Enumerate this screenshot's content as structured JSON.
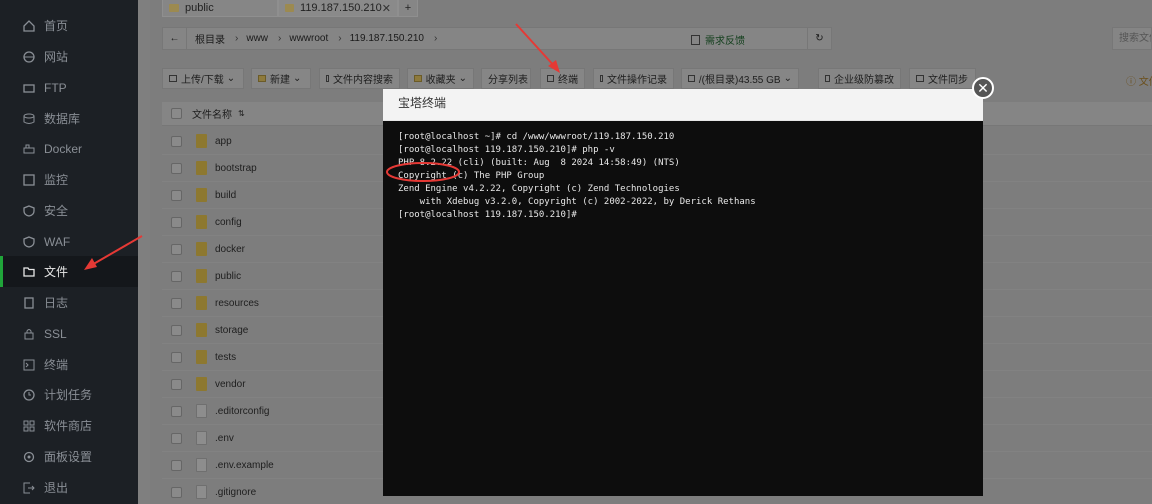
{
  "sidebar": {
    "items": [
      {
        "label": "首页",
        "icon": "home-icon"
      },
      {
        "label": "网站",
        "icon": "globe-icon"
      },
      {
        "label": "FTP",
        "icon": "ftp-icon"
      },
      {
        "label": "数据库",
        "icon": "database-icon"
      },
      {
        "label": "Docker",
        "icon": "docker-icon"
      },
      {
        "label": "监控",
        "icon": "monitor-icon"
      },
      {
        "label": "安全",
        "icon": "shield-icon"
      },
      {
        "label": "WAF",
        "icon": "waf-icon"
      },
      {
        "label": "文件",
        "icon": "folder-icon"
      },
      {
        "label": "日志",
        "icon": "log-icon"
      },
      {
        "label": "SSL",
        "icon": "ssl-icon"
      },
      {
        "label": "终端",
        "icon": "terminal-icon"
      },
      {
        "label": "计划任务",
        "icon": "clock-icon"
      },
      {
        "label": "软件商店",
        "icon": "store-icon"
      },
      {
        "label": "面板设置",
        "icon": "gear-icon"
      },
      {
        "label": "退出",
        "icon": "logout-icon"
      }
    ],
    "active_index": 8
  },
  "tabs": [
    {
      "label": "public"
    },
    {
      "label": "119.187.150.210"
    }
  ],
  "address": {
    "crumbs": [
      "根目录",
      "www",
      "wwwroot",
      "119.187.150.210"
    ]
  },
  "feedback_label": "需求反馈",
  "search_placeholder": "搜索文件/目录",
  "toolbar": {
    "upload": "上传/下载",
    "new": "新建",
    "content_search": "文件内容搜索",
    "favorites": "收藏夹",
    "share_list": "分享列表",
    "terminal": "终端",
    "op_log": "文件操作记录",
    "disk": "/(根目录)43.55 GB",
    "tamper": "企业级防篡改",
    "sync": "文件同步",
    "tip": "文件"
  },
  "table": {
    "header_name": "文件名称",
    "rows": [
      {
        "name": "app",
        "type": "folder"
      },
      {
        "name": "bootstrap",
        "type": "folder"
      },
      {
        "name": "build",
        "type": "folder"
      },
      {
        "name": "config",
        "type": "folder"
      },
      {
        "name": "docker",
        "type": "folder"
      },
      {
        "name": "public",
        "type": "folder"
      },
      {
        "name": "resources",
        "type": "folder"
      },
      {
        "name": "storage",
        "type": "folder"
      },
      {
        "name": "tests",
        "type": "folder"
      },
      {
        "name": "vendor",
        "type": "folder"
      },
      {
        "name": ".editorconfig",
        "type": "file"
      },
      {
        "name": ".env",
        "type": "file"
      },
      {
        "name": ".env.example",
        "type": "file"
      },
      {
        "name": ".gitignore",
        "type": "file"
      }
    ]
  },
  "modal": {
    "title": "宝塔终端",
    "lines": [
      "[root@localhost ~]# cd /www/wwwroot/119.187.150.210",
      "[root@localhost 119.187.150.210]# php -v",
      "PHP 8.2.22 (cli) (built: Aug  8 2024 14:58:49) (NTS)",
      "Copyright (c) The PHP Group",
      "Zend Engine v4.2.22, Copyright (c) Zend Technologies",
      "    with Xdebug v3.2.0, Copyright (c) 2002-2022, by Derick Rethans",
      "[root@localhost 119.187.150.210]#"
    ]
  },
  "colors": {
    "sidebar_bg": "#1c2025",
    "active_accent": "#20a53a",
    "annotation_red": "#e53935",
    "terminal_bg": "#0d0d0d"
  }
}
